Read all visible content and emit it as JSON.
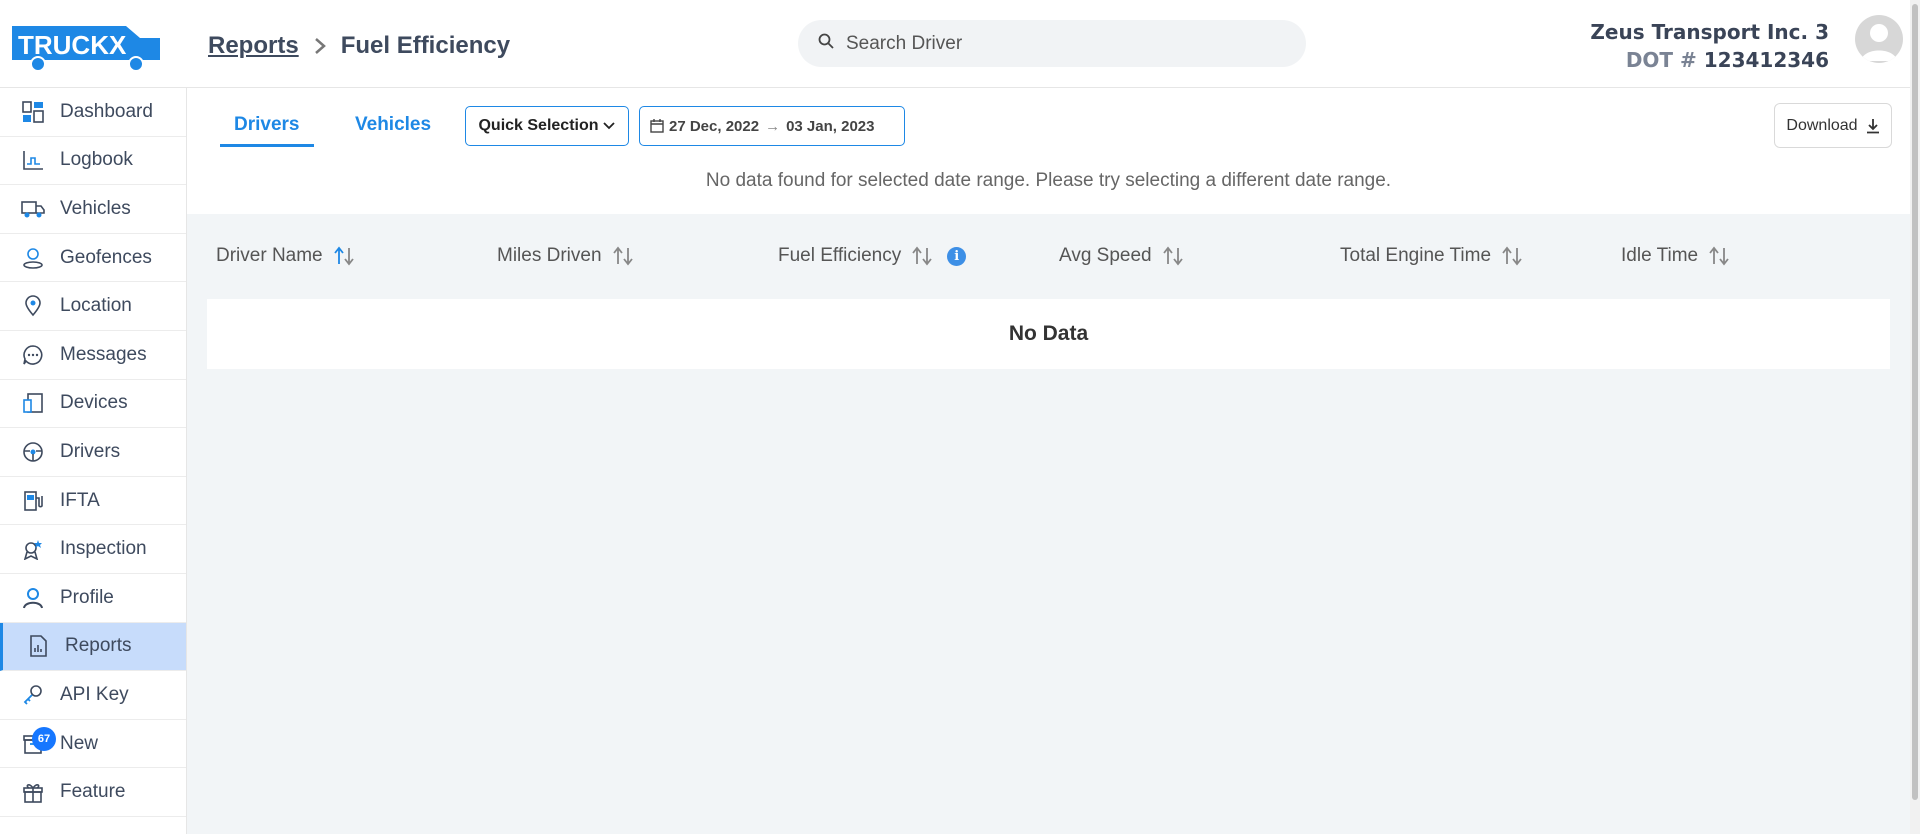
{
  "brand": {
    "logo_text": "TRUCKX",
    "accent": "#1e88e5"
  },
  "breadcrumb": {
    "parent": "Reports",
    "current": "Fuel Efficiency",
    "separator_icon": "chevron-right-icon"
  },
  "search": {
    "placeholder": "Search Driver",
    "value": "",
    "icon": "search-icon"
  },
  "account": {
    "company": "Zeus Transport Inc. 3",
    "dot_label": "DOT #",
    "dot_number": "123412346"
  },
  "sidebar": {
    "items": [
      {
        "label": "Dashboard",
        "icon": "dashboard-icon"
      },
      {
        "label": "Logbook",
        "icon": "logbook-icon"
      },
      {
        "label": "Vehicles",
        "icon": "truck-icon"
      },
      {
        "label": "Geofences",
        "icon": "geofence-icon"
      },
      {
        "label": "Location",
        "icon": "location-pin-icon"
      },
      {
        "label": "Messages",
        "icon": "message-icon"
      },
      {
        "label": "Devices",
        "icon": "devices-icon"
      },
      {
        "label": "Drivers",
        "icon": "steering-wheel-icon"
      },
      {
        "label": "IFTA",
        "icon": "fuel-pump-icon"
      },
      {
        "label": "Inspection",
        "icon": "inspection-icon"
      },
      {
        "label": "Profile",
        "icon": "user-icon"
      },
      {
        "label": "Reports",
        "icon": "report-icon",
        "active": true
      },
      {
        "label": "API Key",
        "icon": "key-icon"
      },
      {
        "label": "New",
        "icon": "archive-icon"
      },
      {
        "label": "Feature",
        "icon": "gift-icon"
      }
    ],
    "badge_count": "67"
  },
  "tabs": [
    {
      "label": "Drivers",
      "active": true
    },
    {
      "label": "Vehicles",
      "active": false
    }
  ],
  "filters": {
    "quick_selection": "Quick Selection",
    "date_start": "27 Dec, 2022",
    "date_arrow": "→",
    "date_end": "03 Jan, 2023",
    "download_label": "Download"
  },
  "message": "No data found for selected date range. Please try selecting a different date range.",
  "table": {
    "columns": [
      {
        "label": "Driver Name",
        "sort_active": true
      },
      {
        "label": "Miles Driven"
      },
      {
        "label": "Fuel Efficiency",
        "info": true
      },
      {
        "label": "Avg Speed"
      },
      {
        "label": "Total Engine Time"
      },
      {
        "label": "Idle Time"
      }
    ],
    "empty_text": "No Data"
  }
}
